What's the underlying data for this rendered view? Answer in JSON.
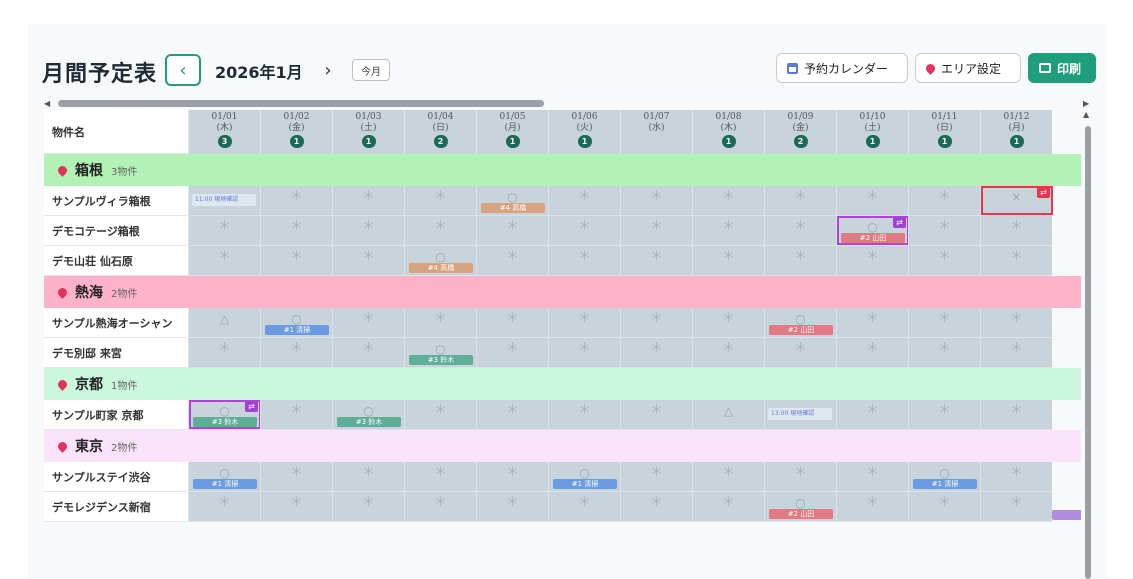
{
  "page": {
    "title": "月間予定表",
    "month": "2026年1月",
    "today_label": "今月",
    "calendar_button": "予約カレンダー",
    "area_button": "エリア設定",
    "print_button": "印刷"
  },
  "grid": {
    "name_header": "物件名",
    "days": [
      {
        "date": "01/01",
        "weekday": "(木)",
        "count": "3"
      },
      {
        "date": "01/02",
        "weekday": "(金)",
        "count": "1"
      },
      {
        "date": "01/03",
        "weekday": "(土)",
        "count": "1"
      },
      {
        "date": "01/04",
        "weekday": "(日)",
        "count": "2"
      },
      {
        "date": "01/05",
        "weekday": "(月)",
        "count": "1"
      },
      {
        "date": "01/06",
        "weekday": "(火)",
        "count": "1"
      },
      {
        "date": "01/07",
        "weekday": "(水)",
        "count": ""
      },
      {
        "date": "01/08",
        "weekday": "(木)",
        "count": "1"
      },
      {
        "date": "01/09",
        "weekday": "(金)",
        "count": "2"
      },
      {
        "date": "01/10",
        "weekday": "(土)",
        "count": "1"
      },
      {
        "date": "01/11",
        "weekday": "(日)",
        "count": "1"
      },
      {
        "date": "01/12",
        "weekday": "(月)",
        "count": "1"
      }
    ],
    "areas": [
      {
        "name": "箱根",
        "count": "3物件",
        "color": "#b2f2b6",
        "properties": [
          {
            "name": "サンプルヴィラ箱根",
            "cells": [
              {
                "note": "11:00 現地確認"
              },
              {
                "mark": "＊"
              },
              {
                "mark": "＊"
              },
              {
                "mark": "＊"
              },
              {
                "mark": "○",
                "tag": "#4 高橋",
                "tagColor": "orange"
              },
              {
                "mark": "＊"
              },
              {
                "mark": "＊"
              },
              {
                "mark": "＊"
              },
              {
                "mark": "＊"
              },
              {
                "mark": "＊"
              },
              {
                "mark": "＊"
              },
              {
                "mark": "×",
                "sel": "red"
              }
            ]
          },
          {
            "name": "デモコテージ箱根",
            "cells": [
              {
                "mark": "＊"
              },
              {
                "mark": "＊"
              },
              {
                "mark": "＊"
              },
              {
                "mark": "＊"
              },
              {
                "mark": "＊"
              },
              {
                "mark": "＊"
              },
              {
                "mark": "＊"
              },
              {
                "mark": "＊"
              },
              {
                "mark": "＊"
              },
              {
                "mark": "○",
                "tag": "#2 山田",
                "tagColor": "red",
                "sel": "purple"
              },
              {
                "mark": "＊"
              },
              {
                "mark": "＊"
              }
            ]
          },
          {
            "name": "デモ山荘 仙石原",
            "cells": [
              {
                "mark": "＊"
              },
              {
                "mark": "＊"
              },
              {
                "mark": "＊"
              },
              {
                "mark": "○",
                "tag": "#4 高橋",
                "tagColor": "orange"
              },
              {
                "mark": "＊"
              },
              {
                "mark": "＊"
              },
              {
                "mark": "＊"
              },
              {
                "mark": "＊"
              },
              {
                "mark": "＊"
              },
              {
                "mark": "＊"
              },
              {
                "mark": "＊"
              },
              {
                "mark": "＊"
              }
            ]
          }
        ]
      },
      {
        "name": "熱海",
        "count": "2物件",
        "color": "#ffb3cb",
        "properties": [
          {
            "name": "サンプル熱海オーシャン",
            "cells": [
              {
                "mark": "△"
              },
              {
                "mark": "○",
                "tag": "#1 清掃",
                "tagColor": "blue"
              },
              {
                "mark": "＊"
              },
              {
                "mark": "＊"
              },
              {
                "mark": "＊"
              },
              {
                "mark": "＊"
              },
              {
                "mark": "＊"
              },
              {
                "mark": "＊"
              },
              {
                "mark": "○",
                "tag": "#2 山田",
                "tagColor": "red"
              },
              {
                "mark": "＊"
              },
              {
                "mark": "＊"
              },
              {
                "mark": "＊"
              }
            ]
          },
          {
            "name": "デモ別邸 来宮",
            "cells": [
              {
                "mark": "＊"
              },
              {
                "mark": "＊"
              },
              {
                "mark": "＊"
              },
              {
                "mark": "○",
                "tag": "#3 鈴木",
                "tagColor": "teal"
              },
              {
                "mark": "＊"
              },
              {
                "mark": "＊"
              },
              {
                "mark": "＊"
              },
              {
                "mark": "＊"
              },
              {
                "mark": "＊"
              },
              {
                "mark": "＊"
              },
              {
                "mark": "＊"
              },
              {
                "mark": "＊"
              }
            ]
          }
        ]
      },
      {
        "name": "京都",
        "count": "1物件",
        "color": "#ccf7df",
        "properties": [
          {
            "name": "サンプル町家 京都",
            "cells": [
              {
                "mark": "○",
                "tag": "#3 鈴木",
                "tagColor": "teal",
                "sel": "purple"
              },
              {
                "mark": "＊"
              },
              {
                "mark": "○",
                "tag": "#3 鈴木",
                "tagColor": "teal"
              },
              {
                "mark": "＊"
              },
              {
                "mark": "＊"
              },
              {
                "mark": "＊"
              },
              {
                "mark": "＊"
              },
              {
                "mark": "△"
              },
              {
                "note": "13:00 現地確認"
              },
              {
                "mark": "＊"
              },
              {
                "mark": "＊"
              },
              {
                "mark": "＊"
              }
            ]
          }
        ]
      },
      {
        "name": "東京",
        "count": "2物件",
        "color": "#fbe4fb",
        "properties": [
          {
            "name": "サンプルステイ渋谷",
            "cells": [
              {
                "mark": "○",
                "tag": "#1 清掃",
                "tagColor": "blue"
              },
              {
                "mark": "＊"
              },
              {
                "mark": "＊"
              },
              {
                "mark": "＊"
              },
              {
                "mark": "＊"
              },
              {
                "mark": "○",
                "tag": "#1 清掃",
                "tagColor": "blue"
              },
              {
                "mark": "＊"
              },
              {
                "mark": "＊"
              },
              {
                "mark": "＊"
              },
              {
                "mark": "＊"
              },
              {
                "mark": "○",
                "tag": "#1 清掃",
                "tagColor": "blue"
              },
              {
                "mark": "＊"
              }
            ]
          },
          {
            "name": "デモレジデンス新宿",
            "cells": [
              {
                "mark": "＊"
              },
              {
                "mark": "＊"
              },
              {
                "mark": "＊"
              },
              {
                "mark": "＊"
              },
              {
                "mark": "＊"
              },
              {
                "mark": "＊"
              },
              {
                "mark": "＊"
              },
              {
                "mark": "＊"
              },
              {
                "mark": "○",
                "tag": "#2 山田",
                "tagColor": "red"
              },
              {
                "mark": "＊"
              },
              {
                "mark": "＊"
              },
              {
                "mark": "＊"
              }
            ]
          }
        ]
      }
    ]
  }
}
